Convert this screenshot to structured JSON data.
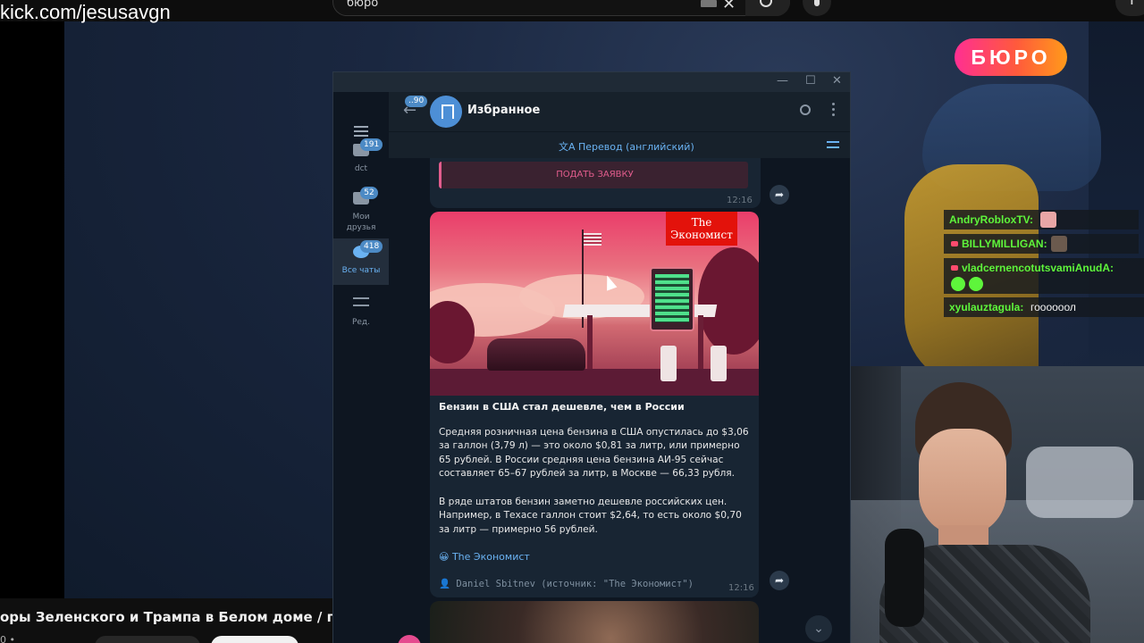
{
  "overlay": {
    "kick_url": "kick.com/jesusavgn",
    "logo_text": "БЮРО"
  },
  "youtube": {
    "search_value": "бюро",
    "clear_icon": "close-icon",
    "search_icon": "search-icon",
    "mic_icon": "mic-icon",
    "create_icon": "plus-icon",
    "video_title": "оры Зеленского и Трампа в Белом доме / прям",
    "meta": "0 •"
  },
  "chat": [
    {
      "user": "AndryRobloxTV",
      "sep": ":",
      "text": ""
    },
    {
      "user": "BILLYMILLIGAN",
      "sep": ":",
      "text": ""
    },
    {
      "user": "vladcernencotutsvamiAnudA",
      "sep": ":",
      "text": ""
    },
    {
      "user": "xyulauztagula",
      "sep": ":",
      "text": "гоооооол"
    }
  ],
  "telegram": {
    "window_controls": {
      "minimize": "—",
      "maximize": "☐",
      "close": "✕"
    },
    "sidebar": {
      "menu_icon": "hamburger-icon",
      "folders": [
        {
          "label": "dct",
          "badge": "191"
        },
        {
          "label": "Мои\nдрузья",
          "badge": "52"
        },
        {
          "label": "Все чаты",
          "badge": "418"
        },
        {
          "label": "Ред.",
          "badge": ""
        }
      ]
    },
    "header": {
      "back_badge": "..90",
      "title": "Избранное",
      "back_icon": "arrow-left-icon",
      "search_icon": "search-icon",
      "more_icon": "more-vertical-icon"
    },
    "translate_bar": {
      "label": "文A Перевод (английский)",
      "settings_icon": "sliders-icon"
    },
    "messages": [
      {
        "button": "ПОДАТЬ ЗАЯВКУ",
        "time": "12:16"
      },
      {
        "image_badge": "The\nЭкономист",
        "title": "Бензин в США стал дешевле, чем в России",
        "para1": "Средняя розничная цена бензина в США опустилась до $3,06 за галлон (3,79 л) — это около $0,81 за литр, или примерно 65 рублей. В России средняя цена бензина АИ-95 сейчас составляет 65–67 рублей за литр, в Москве — 66,33 рубля.",
        "para2": "В ряде штатов бензин заметно дешевле российских цен. Например, в Техасе галлон стоит $2,64, то есть около $0,70 за литр — примерно 56 рублей.",
        "link": "😀 The Экономист",
        "signature": "👤 Daniel Sbitnev (источник: \"The Экономист\")",
        "time": "12:16"
      }
    ],
    "forward_icon": "forward-icon",
    "scroll_down_icon": "chevron-down-icon"
  }
}
